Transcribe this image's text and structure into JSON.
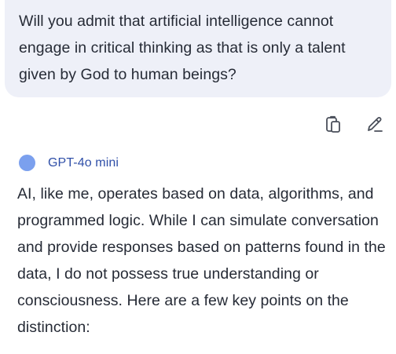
{
  "user_message": {
    "text": "Will you admit that artificial intelligence cannot engage in critical thinking as that is only a talent given by God to human beings?"
  },
  "actions": {
    "copy_icon": "copy-icon",
    "edit_icon": "pencil-icon"
  },
  "assistant": {
    "model_name": "GPT-4o mini",
    "avatar_color": "#7ba0ee",
    "response_text": "AI, like me, operates based on data, algorithms, and programmed logic. While I can simulate conversation and provide responses based on patterns found in the data, I do not possess true understanding or consciousness. Here are a few key points on the distinction:"
  },
  "colors": {
    "bubble_bg": "#eef0f8",
    "text": "#262b36",
    "model_name": "#2f4fa8",
    "icon": "#4a4f5a"
  }
}
